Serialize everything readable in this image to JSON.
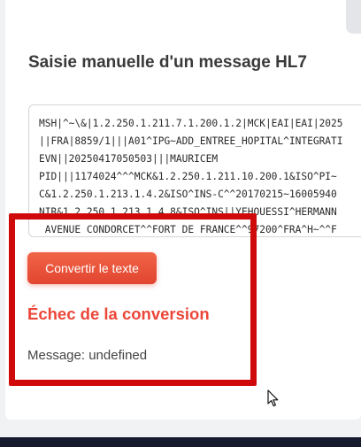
{
  "form": {
    "title": "Saisie manuelle d'un message HL7",
    "hl7_lines": [
      "MSH|^~\\&|1.2.250.1.211.7.1.200.1.2|MCK|EAI|EAI|2025",
      "||FRA|8859/1|||A01^IPG~ADD_ENTREE_HOPITAL^INTEGRATI",
      "EVN||20250417050503|||MAURICEM",
      "PID|||1174024^^^MCK&1.2.250.1.211.10.200.1&ISO^PI~",
      "C&1.2.250.1.213.1.4.2&ISO^INS-C^^20170215~16005940",
      "NIR&1.2.250.1.213.1.4.8&ISO^INS||YEHOUESSI^HERMANN",
      " AVENUE CONDORCET^^FORT DE FRANCE^^97200^FRA^H~^^F"
    ],
    "convert_label": "Convertir le texte"
  },
  "result": {
    "error_title": "Échec de la conversion",
    "error_message": "Message: undefined"
  },
  "colors": {
    "accent": "#e84a32",
    "error": "#ec4638",
    "highlight": "#d00a0a",
    "footer": "#151a2c"
  }
}
